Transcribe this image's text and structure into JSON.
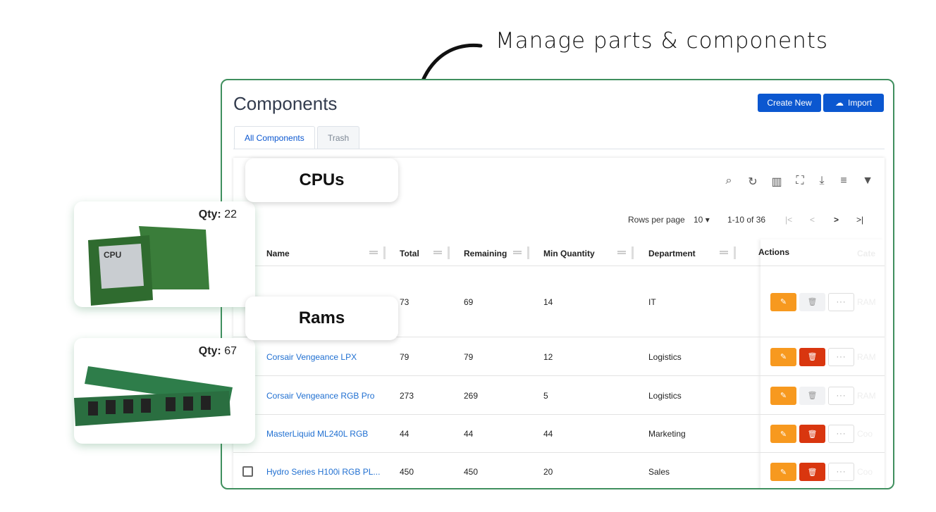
{
  "annotation": "Manage parts & components",
  "page": {
    "title": "Components",
    "create_label": "Create New",
    "import_label": "Import"
  },
  "tabs": [
    {
      "label": "All Components",
      "active": true
    },
    {
      "label": "Trash",
      "active": false
    }
  ],
  "pagination": {
    "rows_label": "Rows per page",
    "rows_value": "10",
    "range": "1-10 of 36"
  },
  "columns": [
    "Name",
    "Total",
    "Remaining",
    "Min Quantity",
    "Department",
    "Actions",
    "Cate"
  ],
  "rows": [
    {
      "name": "",
      "total": "73",
      "remaining": "69",
      "min": "14",
      "department": "IT",
      "category": "RAM",
      "deletable": false
    },
    {
      "name": "Corsair Vengeance LPX",
      "total": "79",
      "remaining": "79",
      "min": "12",
      "department": "Logistics",
      "category": "RAM",
      "deletable": true
    },
    {
      "name": "Corsair Vengeance RGB Pro",
      "total": "273",
      "remaining": "269",
      "min": "5",
      "department": "Logistics",
      "category": "RAM",
      "deletable": false
    },
    {
      "name": "MasterLiquid ML240L RGB",
      "total": "44",
      "remaining": "44",
      "min": "44",
      "department": "Marketing",
      "category": "Coo",
      "deletable": true
    },
    {
      "name": "Hydro Series H100i RGB PL...",
      "total": "450",
      "remaining": "450",
      "min": "20",
      "department": "Sales",
      "category": "Coo",
      "deletable": true
    }
  ],
  "callouts": [
    {
      "title": "CPUs",
      "qty_label": "Qty:",
      "qty": "22",
      "chip_text": "CPU"
    },
    {
      "title": "Rams",
      "qty_label": "Qty:",
      "qty": "67"
    }
  ],
  "colors": {
    "primary": "#0b57d0",
    "edit": "#f7991f",
    "delete": "#d9360f",
    "frame": "#3f8f5e"
  }
}
